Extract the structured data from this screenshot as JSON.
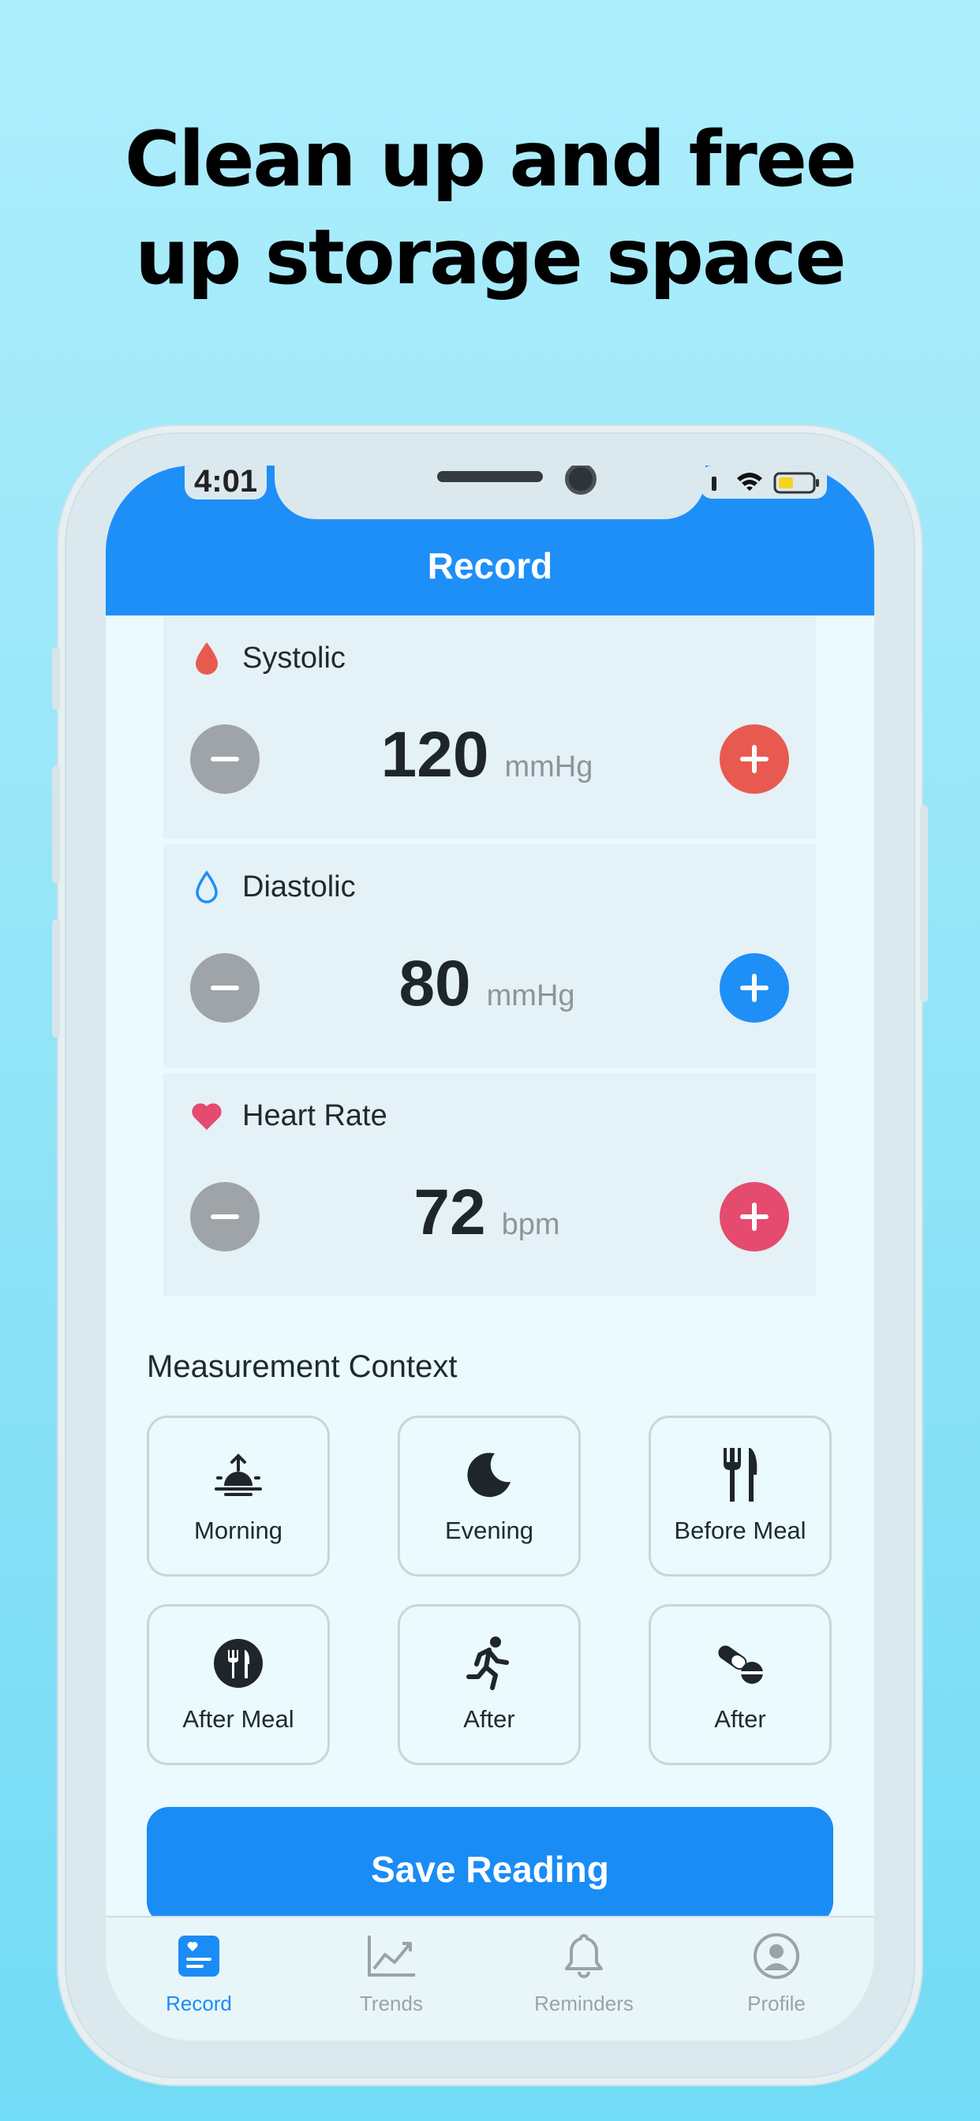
{
  "headline": {
    "line1": "Clean up and free",
    "line2": "up storage space"
  },
  "status_bar": {
    "time": "4:01"
  },
  "header": {
    "title": "Record"
  },
  "vitals": [
    {
      "label": "Systolic",
      "value": "120",
      "unit": "mmHg",
      "icon": "blood-drop-icon",
      "accent": "#e85a50"
    },
    {
      "label": "Diastolic",
      "value": "80",
      "unit": "mmHg",
      "icon": "water-drop-outline-icon",
      "accent": "#1e8ff7"
    },
    {
      "label": "Heart Rate",
      "value": "72",
      "unit": "bpm",
      "icon": "heart-icon",
      "accent": "#e54a6f"
    }
  ],
  "context": {
    "title": "Measurement Context",
    "options": [
      {
        "label": "Morning",
        "icon": "sunrise-icon"
      },
      {
        "label": "Evening",
        "icon": "moon-icon"
      },
      {
        "label": "Before Meal",
        "icon": "fork-knife-icon"
      },
      {
        "label": "After Meal",
        "icon": "fork-knife-circle-icon"
      },
      {
        "label": "After",
        "icon": "running-icon"
      },
      {
        "label": "After",
        "icon": "pills-icon"
      }
    ]
  },
  "save_button": {
    "label": "Save Reading"
  },
  "tabbar": {
    "tabs": [
      {
        "label": "Record",
        "icon": "record-icon",
        "active": true
      },
      {
        "label": "Trends",
        "icon": "chart-icon",
        "active": false
      },
      {
        "label": "Reminders",
        "icon": "bell-icon",
        "active": false
      },
      {
        "label": "Profile",
        "icon": "profile-icon",
        "active": false
      }
    ]
  },
  "colors": {
    "primary": "#1e8ff7",
    "inactive": "#9aa3a8",
    "minus": "#9ea4a8"
  }
}
